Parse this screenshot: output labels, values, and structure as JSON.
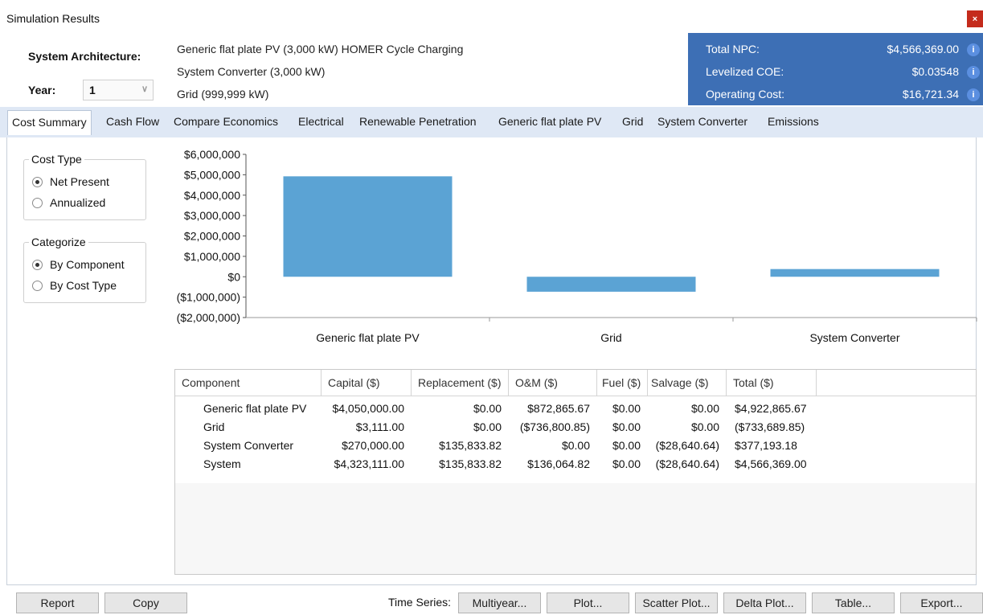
{
  "window": {
    "title": "Simulation Results",
    "close_label": "×"
  },
  "architecture": {
    "label": "System Architecture:",
    "lines": [
      "Generic flat plate PV (3,000 kW)  HOMER Cycle Charging",
      "System Converter (3,000 kW)",
      "Grid (999,999 kW)"
    ]
  },
  "year": {
    "label": "Year:",
    "value": "1"
  },
  "summary": {
    "rows": [
      {
        "label": "Total NPC:",
        "value": "$4,566,369.00"
      },
      {
        "label": "Levelized COE:",
        "value": "$0.03548"
      },
      {
        "label": "Operating Cost:",
        "value": "$16,721.34"
      }
    ],
    "info_icon": "i"
  },
  "tabs": [
    "Cost Summary",
    "Cash Flow",
    "Compare Economics",
    "Electrical",
    "Renewable Penetration",
    "Generic flat plate PV",
    "Grid",
    "System Converter",
    "Emissions"
  ],
  "cost_type": {
    "title": "Cost Type",
    "options": [
      "Net Present",
      "Annualized"
    ],
    "selected": 0
  },
  "categorize": {
    "title": "Categorize",
    "options": [
      "By Component",
      "By Cost Type"
    ],
    "selected": 0
  },
  "chart_data": {
    "type": "bar",
    "categories": [
      "Generic flat plate PV",
      "Grid",
      "System Converter"
    ],
    "values": [
      4922865.67,
      -733689.85,
      377193.18
    ],
    "ylim": [
      -2000000,
      6000000
    ],
    "yticks": [
      "$6,000,000",
      "$5,000,000",
      "$4,000,000",
      "$3,000,000",
      "$2,000,000",
      "$1,000,000",
      "$0",
      "($1,000,000)",
      "($2,000,000)"
    ],
    "bar_color": "#5ba3d4",
    "xlabel": "",
    "ylabel": "",
    "title": ""
  },
  "table": {
    "headers": [
      "Component",
      "Capital ($)",
      "Replacement ($)",
      "O&M ($)",
      "Fuel ($)",
      "Salvage ($)",
      "Total ($)"
    ],
    "rows": [
      [
        "Generic flat plate PV",
        "$4,050,000.00",
        "$0.00",
        "$872,865.67",
        "$0.00",
        "$0.00",
        "$4,922,865.67"
      ],
      [
        "Grid",
        "$3,111.00",
        "$0.00",
        "($736,800.85)",
        "$0.00",
        "$0.00",
        "($733,689.85)"
      ],
      [
        "System Converter",
        "$270,000.00",
        "$135,833.82",
        "$0.00",
        "$0.00",
        "($28,640.64)",
        "$377,193.18"
      ],
      [
        "System",
        "$4,323,111.00",
        "$135,833.82",
        "$136,064.82",
        "$0.00",
        "($28,640.64)",
        "$4,566,369.00"
      ]
    ]
  },
  "footer": {
    "report": "Report",
    "copy": "Copy",
    "time_series_label": "Time Series:",
    "multiyear": "Multiyear...",
    "plot": "Plot...",
    "scatter": "Scatter Plot...",
    "delta": "Delta Plot...",
    "table": "Table...",
    "export": "Export..."
  }
}
